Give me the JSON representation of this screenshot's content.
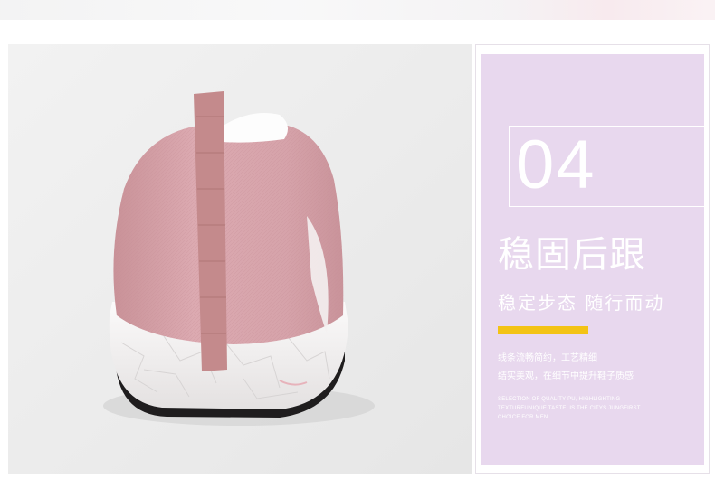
{
  "feature": {
    "number": "04",
    "title": "稳固后跟",
    "subtitle": "稳定步态 随行而动",
    "desc_lines": [
      "线条流畅简约，工艺精细",
      "结实美观，在细节中提升鞋子质感"
    ],
    "english_lines": [
      "SELECTION OF QUALITY PU, HIGHLIGHTING",
      "TEXTUREUNIQUE TASTE, IS THE CITYS JUNGFIRST",
      "CHOICE FOR MEN"
    ]
  },
  "colors": {
    "panel_bg": "#e8d8ee",
    "accent": "#f3c315",
    "shoe_knit": "#d7a6ac",
    "shoe_tab": "#c48a8c",
    "sole": "#f2f0f0"
  }
}
